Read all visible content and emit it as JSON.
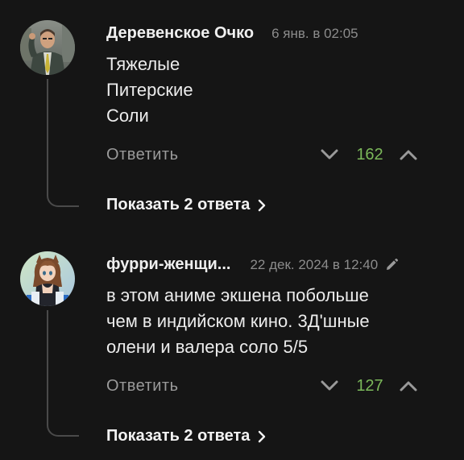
{
  "comments": [
    {
      "author": "Деревенское Очко",
      "time": "6 янв. в 02:05",
      "text_lines": [
        "Тяжелые",
        "Питерские",
        "Соли"
      ],
      "reply_label": "Ответить",
      "score": "162",
      "show_replies_label": "Показать 2 ответа",
      "avatar_icon": "man-in-suit-avatar",
      "edited": false
    },
    {
      "author": "фурри-женщи...",
      "time": "22 дек. 2024 в 12:40",
      "text_lines": [
        "в этом аниме экшена побольше",
        "чем в индийском кино. 3Д'шные",
        "олени и валера соло 5/5"
      ],
      "reply_label": "Ответить",
      "score": "127",
      "show_replies_label": "Показать 2 ответа",
      "avatar_icon": "anime-girl-avatar",
      "edited": true
    }
  ],
  "colors": {
    "background": "#151515",
    "score_positive": "#7bb85a",
    "muted_text": "#8c8c8c",
    "thread_line": "#4a4a4a"
  }
}
